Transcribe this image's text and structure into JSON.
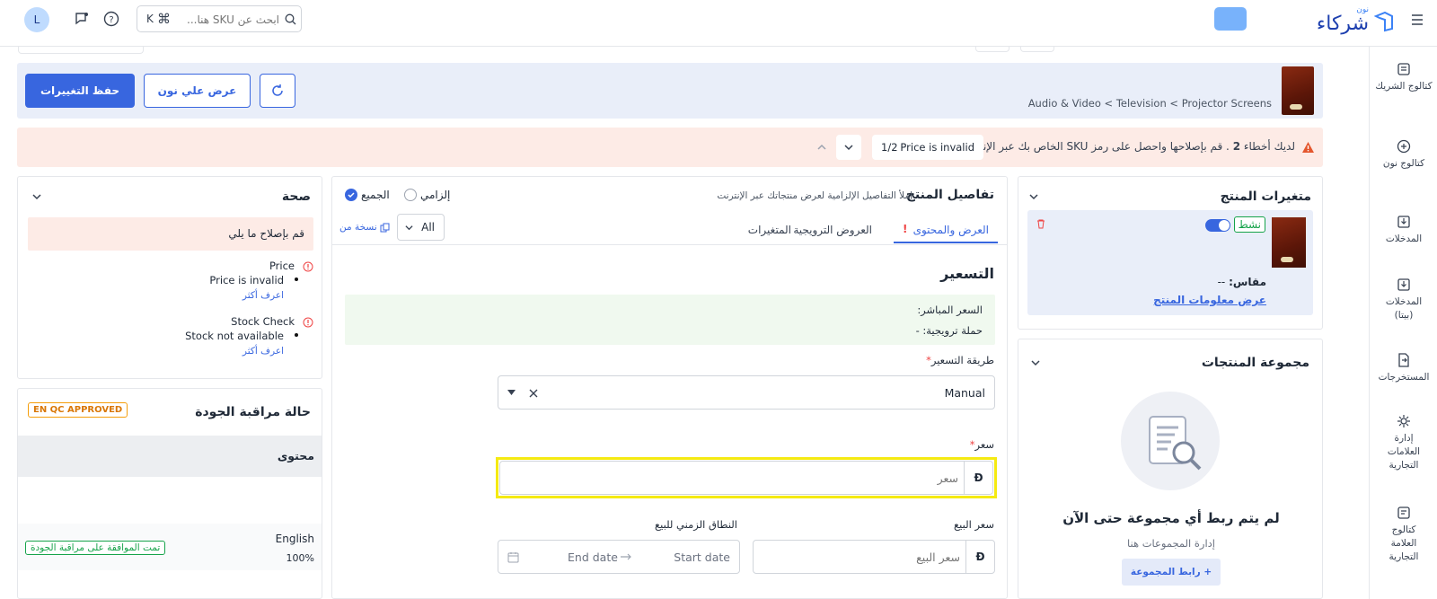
{
  "header": {
    "brand_small": "نون",
    "brand_main": "شركاء",
    "search_placeholder": "ابحث عن SKU هنا...",
    "shortcut_cmd": "⌘",
    "shortcut_key": "K",
    "avatar_letter": "L"
  },
  "sidebar": {
    "items": [
      {
        "label": "كتالوج الشريك",
        "icon": "catalog-icon"
      },
      {
        "label": "كتالوج نون",
        "icon": "noon-catalog-icon"
      },
      {
        "label": "المدخلات",
        "icon": "inbox-icon"
      },
      {
        "label": "المدخلات (بيتا)",
        "icon": "inbox-beta-icon"
      },
      {
        "label": "المستخرجات",
        "icon": "export-icon"
      },
      {
        "label": "إدارة العلامات التجارية",
        "icon": "brand-gear-icon"
      },
      {
        "label": "كتالوج العلامة التجارية",
        "icon": "brand-catalog-icon"
      }
    ]
  },
  "product_bar": {
    "breadcrumb": "Audio & Video < Television < Projector Screens",
    "save_label": "حفظ التغييرات",
    "view_label": "عرض علي نون"
  },
  "alert": {
    "prefix": "لديك أخطاء",
    "count": "2",
    "message": ". قم بإصلاحها واحصل على رمز SKU الخاص بك عبر الإنترنت",
    "error_text": "Price is invalid",
    "pager": "1/2"
  },
  "variants": {
    "title": "متغيرات المنتج",
    "active_badge": "نشط",
    "size_label": "مقاس:",
    "size_value": "--",
    "view_info_link": "عرض معلومات المنتج"
  },
  "groups": {
    "title": "مجموعة المنتجات",
    "empty_title": "لم يتم ربط أي مجموعة حتى الآن",
    "empty_sub": "إدارة المجموعات هنا",
    "link_button": "+ رابط المجموعة"
  },
  "details": {
    "title": "تفاصيل المنتج",
    "subtitle": "املأ التفاصيل الإلزامية لعرض منتجاتك عبر الإنترنت",
    "filter_all_label": "الجميع",
    "filter_required_label": "إلزامي",
    "tabs": [
      "العرض والمحتوى",
      "العروض الترويجية",
      "المتغيرات"
    ],
    "tab_alert": "!",
    "lang_select": "All",
    "copy_from": "نسخة من",
    "pricing_title": "التسعير",
    "live_price_label": "السعر المباشر:",
    "promo_label": "حملة ترويجية:",
    "promo_value": "-",
    "pricing_method_label": "طريقة التسعير",
    "pricing_method_value": "Manual",
    "price_label": "سعر",
    "price_placeholder": "سعر",
    "currency_symbol": "Đ",
    "sale_price_label": "سعر البيع",
    "sale_price_placeholder": "سعر البيع",
    "sale_range_label": "النطاق الزمني للبيع",
    "start_date_placeholder": "Start date",
    "end_date_placeholder": "End date",
    "required_mark": "*"
  },
  "health": {
    "title": "صحة",
    "fix_banner": "قم بإصلاح ما يلي",
    "issues": [
      {
        "title": "Price",
        "detail": "Price is invalid",
        "learn_more": "اعرف أكثر"
      },
      {
        "title": "Stock Check",
        "detail": "Stock not available",
        "learn_more": "اعرف أكثر"
      }
    ]
  },
  "qc": {
    "title": "حالة مراقبة الجودة",
    "badge": "EN QC APPROVED",
    "content_header": "محتوى",
    "language": "English",
    "percent": "100%",
    "approved_badge": "تمت الموافقة على مراقبة الجودة"
  },
  "colors": {
    "primary": "#3866df",
    "alert_bg": "#fdebe6",
    "success": "#16a34a",
    "warning": "#f59e0b",
    "highlight": "#f5ea12"
  }
}
